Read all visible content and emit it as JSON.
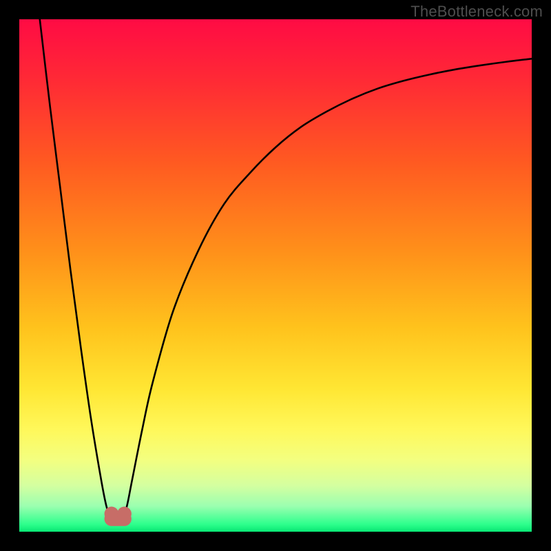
{
  "watermark": "TheBottleneck.com",
  "colors": {
    "frame": "#000000",
    "curve": "#000000",
    "marker": "#c76d67",
    "gradient_stops": [
      {
        "offset": 0.0,
        "color": "#ff0b44"
      },
      {
        "offset": 0.12,
        "color": "#ff2a35"
      },
      {
        "offset": 0.28,
        "color": "#ff5a21"
      },
      {
        "offset": 0.45,
        "color": "#ff8f1a"
      },
      {
        "offset": 0.6,
        "color": "#ffc21c"
      },
      {
        "offset": 0.72,
        "color": "#ffe633"
      },
      {
        "offset": 0.8,
        "color": "#fff85a"
      },
      {
        "offset": 0.86,
        "color": "#f3ff80"
      },
      {
        "offset": 0.91,
        "color": "#d4ffa0"
      },
      {
        "offset": 0.95,
        "color": "#9bffb0"
      },
      {
        "offset": 0.985,
        "color": "#2fff8d"
      },
      {
        "offset": 1.0,
        "color": "#08e874"
      }
    ]
  },
  "chart_data": {
    "type": "line",
    "title": "",
    "xlabel": "",
    "ylabel": "",
    "xlim": [
      0,
      100
    ],
    "ylim": [
      0,
      100
    ],
    "grid": false,
    "legend": false,
    "series": [
      {
        "name": "bottleneck-curve",
        "x": [
          4,
          6,
          8,
          10,
          12,
          14,
          16,
          17,
          18,
          19,
          20,
          21,
          22,
          24,
          26,
          30,
          35,
          40,
          45,
          50,
          55,
          60,
          65,
          70,
          75,
          80,
          85,
          90,
          95,
          100
        ],
        "y": [
          100,
          83,
          67,
          51,
          36,
          22,
          10,
          5,
          2,
          1.5,
          2,
          5,
          10,
          20,
          29,
          43,
          55,
          64,
          70,
          75,
          79,
          82,
          84.5,
          86.5,
          88,
          89.2,
          90.2,
          91,
          91.7,
          92.3
        ]
      }
    ],
    "markers": [
      {
        "x": 18,
        "y": 3.5,
        "r": 1.4
      },
      {
        "x": 20.5,
        "y": 3.5,
        "r": 1.4
      }
    ],
    "valley_bar": {
      "x0": 18,
      "x1": 20.5,
      "y": 2.5,
      "thickness": 1.4
    }
  }
}
